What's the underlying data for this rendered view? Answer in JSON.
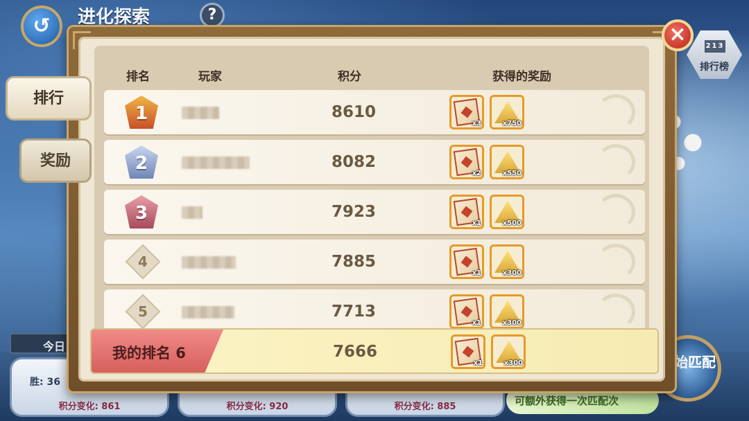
{
  "header": {
    "back_icon": "↺",
    "title": "进化探索",
    "help": "?"
  },
  "leaderboard_button": {
    "podium": "213",
    "label": "排行榜"
  },
  "close_icon": "×",
  "tabs": [
    {
      "label": "排行",
      "active": true
    },
    {
      "label": "奖励",
      "active": false
    }
  ],
  "table": {
    "headers": {
      "rank": "排名",
      "player": "玩家",
      "score": "积分",
      "rewards": "获得的奖励"
    },
    "rows": [
      {
        "rank": "1",
        "score": "8610",
        "card_qty": "x3",
        "gold_qty": "x750",
        "medal_color": "#c8502a"
      },
      {
        "rank": "2",
        "score": "8082",
        "card_qty": "x2",
        "gold_qty": "x550",
        "medal_color": "#6f86b5"
      },
      {
        "rank": "3",
        "score": "7923",
        "card_qty": "x1",
        "gold_qty": "x500",
        "medal_color": "#a8495a"
      },
      {
        "rank": "4",
        "score": "7885",
        "card_qty": "x1",
        "gold_qty": "x300"
      },
      {
        "rank": "5",
        "score": "7713",
        "card_qty": "x1",
        "gold_qty": "x300"
      }
    ]
  },
  "my_rank": {
    "label": "我的排名 6",
    "score": "7666",
    "card_qty": "x1",
    "gold_qty": "x300"
  },
  "background": {
    "today_label": "今日",
    "wins_prefix": "胜: 36",
    "score_changes": [
      "积分变化: 861",
      "积分变化: 920",
      "积分变化: 885"
    ],
    "banner": "可额外获得一次匹配次",
    "start_match": "开始匹配"
  }
}
